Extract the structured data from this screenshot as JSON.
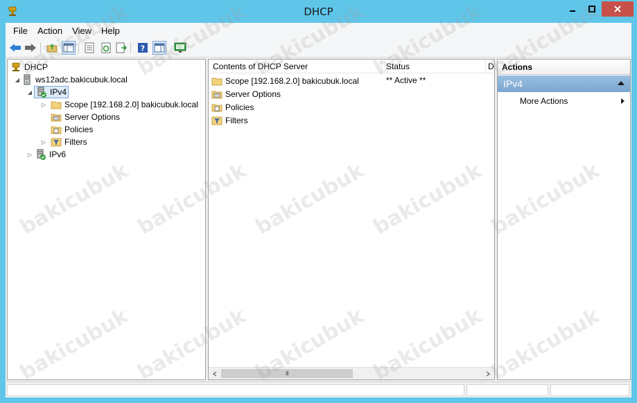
{
  "window": {
    "title": "DHCP"
  },
  "menu": [
    "File",
    "Action",
    "View",
    "Help"
  ],
  "tree": {
    "root": "DHCP",
    "server": "ws12adc.bakicubuk.local",
    "ipv4": "IPv4",
    "scope": "Scope [192.168.2.0] bakicubuk.local",
    "server_options": "Server Options",
    "policies": "Policies",
    "filters": "Filters",
    "ipv6": "IPv6"
  },
  "list": {
    "columns": [
      "Contents of DHCP Server",
      "Status",
      "D"
    ],
    "rows": [
      {
        "name": "Scope [192.168.2.0] bakicubuk.local",
        "status": "** Active **",
        "icon": "folder-icon"
      },
      {
        "name": "Server Options",
        "status": "",
        "icon": "server-options-icon"
      },
      {
        "name": "Policies",
        "status": "",
        "icon": "policies-icon"
      },
      {
        "name": "Filters",
        "status": "",
        "icon": "filters-icon"
      }
    ],
    "hscroll_grip": "III"
  },
  "actions": {
    "header": "Actions",
    "section": "IPv4",
    "more_actions": "More Actions"
  },
  "watermark_text": "bakicubuk",
  "colors": {
    "titlebar": "#5fc6ea",
    "close_button": "#c7504a",
    "selection_border": "#7aa7d6",
    "actions_section": "#7aa6cf"
  }
}
